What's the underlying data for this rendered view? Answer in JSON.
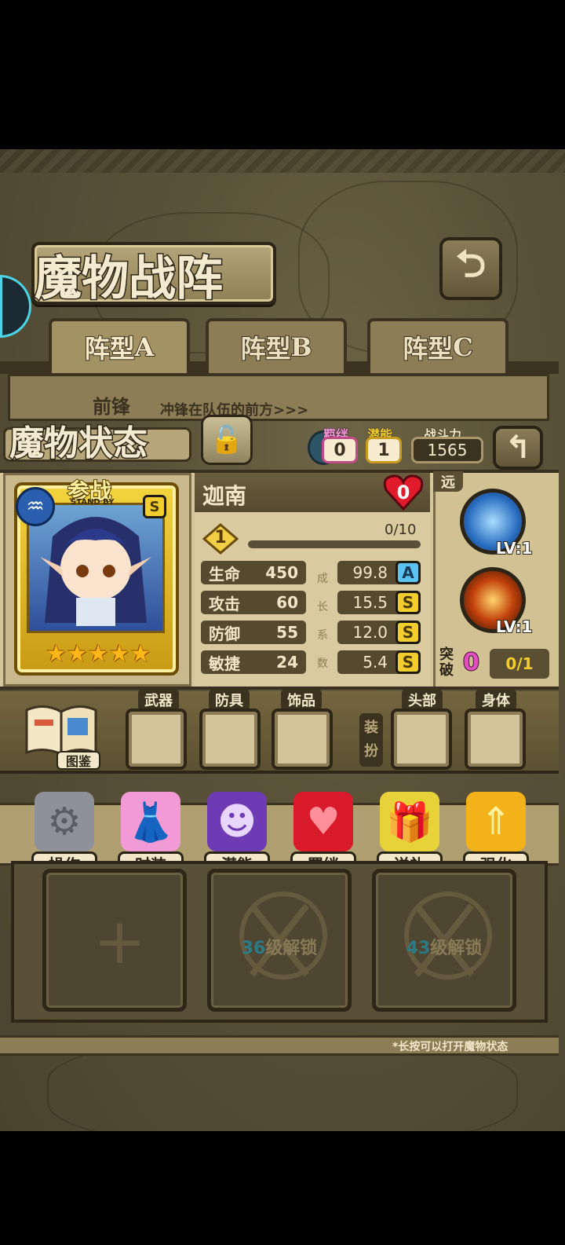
{
  "screen": {
    "title": "魔物战阵",
    "formation_tabs": [
      {
        "label": "阵型",
        "letter": "A",
        "active": true
      },
      {
        "label": "阵型",
        "letter": "B",
        "active": false
      },
      {
        "label": "阵型",
        "letter": "C",
        "active": false
      }
    ],
    "section_vanguard": "前锋",
    "section_vanguard_desc": "冲锋在队伍的前方>>>",
    "back_icon": "back-arrow-icon"
  },
  "status": {
    "title": "魔物状态",
    "lock_icon": "padlock-icon",
    "bond_label": "羁绊",
    "bond_value": "0",
    "potential_label": "潜能",
    "potential_value": "1",
    "power_label": "战斗力",
    "power_value": "1565"
  },
  "monster": {
    "name": "迦南",
    "standby_cn": "参战",
    "standby_en": "STAND BY",
    "rank_badge": "S",
    "stars": "★★★★★",
    "hearts": "0",
    "level": "1",
    "exp": "0/10",
    "exp_progress": 0,
    "growth_caption": [
      "成",
      "长",
      "系",
      "数"
    ],
    "stats": [
      {
        "label": "生命",
        "value": "450",
        "growth": "99.8",
        "grade": "A"
      },
      {
        "label": "攻击",
        "value": "60",
        "growth": "15.5",
        "grade": "S"
      },
      {
        "label": "防御",
        "value": "55",
        "growth": "12.0",
        "grade": "S"
      },
      {
        "label": "敏捷",
        "value": "24",
        "growth": "5.4",
        "grade": "S"
      }
    ],
    "range_tag": "远",
    "skills": [
      {
        "level": "LV:1",
        "color": "#3f8fd8"
      },
      {
        "level": "LV:1",
        "color": "#d45a12"
      }
    ],
    "breakthrough_label": "突破",
    "breakthrough_count": "0",
    "breakthrough_progress": "0/1"
  },
  "equipment": {
    "book_label": "图鉴",
    "slots": [
      "武器",
      "防具",
      "饰品"
    ],
    "dress_label": "装扮",
    "dress_slots": [
      "头部",
      "身体"
    ]
  },
  "actions": [
    {
      "label": "操作",
      "icon": "gear-icon",
      "color": "#8e9197"
    },
    {
      "label": "时装",
      "icon": "outfit-icon",
      "color": "#f19ad6"
    },
    {
      "label": "潜能",
      "icon": "demon-icon",
      "color": "#6e3bb5"
    },
    {
      "label": "羁绊",
      "icon": "hearts-icon",
      "color": "#d81a2a"
    },
    {
      "label": "送礼",
      "icon": "gift-icon",
      "color": "#e8d23a"
    },
    {
      "label": "强化",
      "icon": "upgrade-arrows-icon",
      "color": "#f3b21a"
    }
  ],
  "team_slots": [
    {
      "type": "add"
    },
    {
      "type": "locked",
      "level": "36",
      "suffix": "级解锁"
    },
    {
      "type": "locked",
      "level": "43",
      "suffix": "级解锁"
    }
  ],
  "hint": "*长按可以打开魔物状态"
}
